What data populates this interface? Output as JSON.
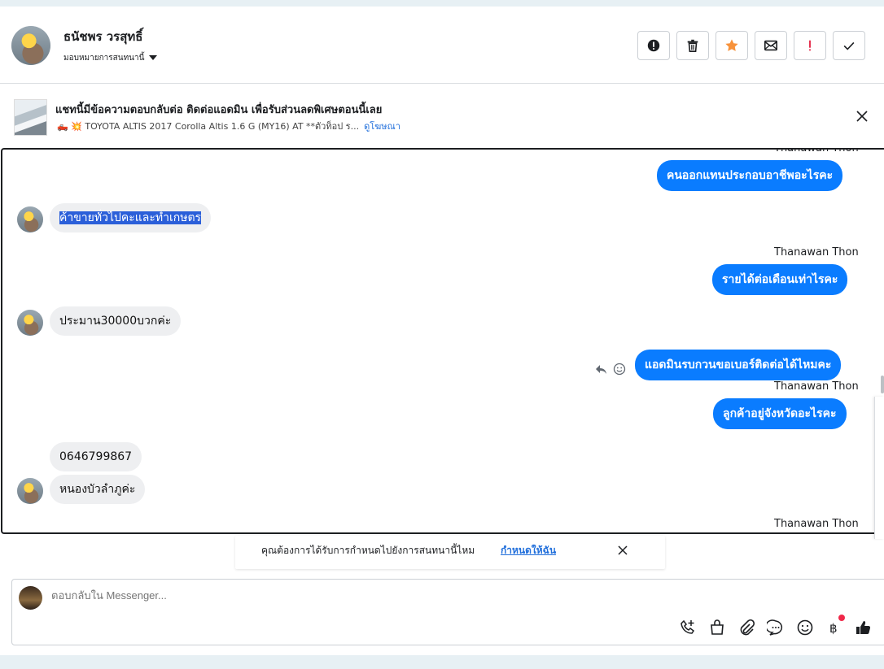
{
  "header": {
    "contact_name": "ธนัชพร วรสุทธิ์",
    "assign_label": "มอบหมายการสนทนานี้",
    "tools": [
      {
        "name": "report-icon",
        "color": "#1c1e21"
      },
      {
        "name": "trash-icon",
        "color": "#1c1e21"
      },
      {
        "name": "star-icon",
        "color": "#f7923b"
      },
      {
        "name": "mail-icon",
        "color": "#1c1e21"
      },
      {
        "name": "exclamation-icon",
        "color": "#e41e3f"
      },
      {
        "name": "check-icon",
        "color": "#1c1e21"
      }
    ]
  },
  "ad": {
    "title": "แชทนี้มีข้อความตอบกลับต่อ ติดต่อแอดมิน เพื่อรับส่วนลดพิเศษตอนนี้เลย",
    "subtitle": "🛻 💥 TOYOTA ALTIS 2017 Corolla Altis 1.6 G (MY16) AT **ตัวท็อป ร...",
    "link": "ดูโฆษณา"
  },
  "conversation": {
    "messages": [
      {
        "direction": "out",
        "sender": "Thanawan Thon",
        "text": "คนออกแทนประกอบอาชีพอะไรคะ"
      },
      {
        "direction": "in",
        "text": "ค้าขายทั่วไปคะและทำเกษตร",
        "highlighted": true
      },
      {
        "direction": "out",
        "sender": "Thanawan Thon",
        "text": "รายได้ต่อเดือนเท่าไรคะ"
      },
      {
        "direction": "in",
        "text": "ประมาน30000บวกค่ะ"
      },
      {
        "direction": "out",
        "text": "แอดมินรบกวนขอเบอร์ติดต่อได้ไหมคะ"
      },
      {
        "direction": "out",
        "sender": "Thanawan Thon",
        "text": "ลูกค้าอยู่จังหวัดอะไรคะ"
      },
      {
        "direction": "in",
        "text": "0646799867"
      },
      {
        "direction": "in",
        "text": "หนองบัวลำภูค่ะ"
      },
      {
        "direction": "out",
        "sender": "Thanawan Thon",
        "text": ""
      }
    ]
  },
  "suggestion": {
    "text": "คุณต้องการได้รับการกำหนดไปยังการสนทนานี้ไหม",
    "link": "กำหนดให้ฉัน"
  },
  "composer": {
    "placeholder": "ตอบกลับใน Messenger...",
    "icons": [
      "call-add-icon",
      "shopping-bag-icon",
      "paperclip-icon",
      "saved-reply-icon",
      "emoji-icon",
      "baht-icon",
      "thumbs-up-icon"
    ]
  },
  "colors": {
    "accent": "#0a7cff",
    "link": "#216fdb",
    "incoming_bubble": "#eeeff1",
    "highlight": "#2b5fd9",
    "notification": "#f02849"
  }
}
